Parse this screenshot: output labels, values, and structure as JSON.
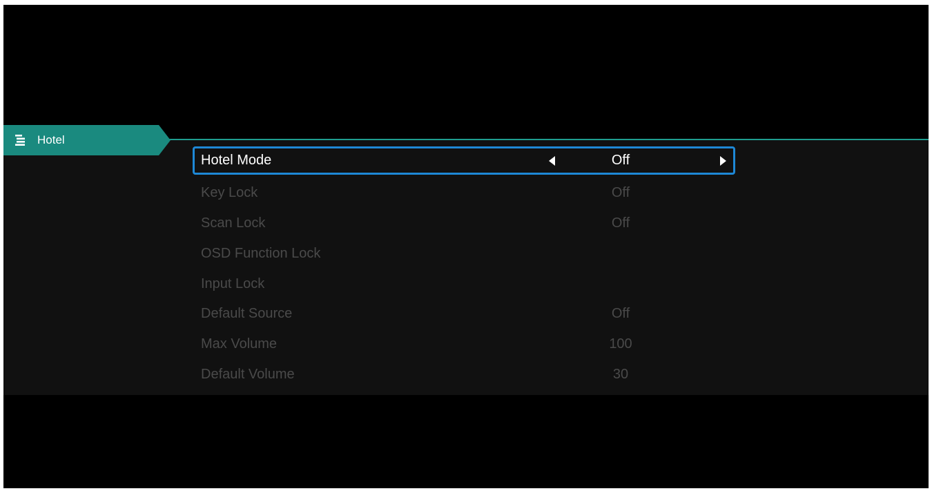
{
  "tab": {
    "label": "Hotel",
    "icon": "menu-list-icon"
  },
  "colors": {
    "accent": "#1a8a7f",
    "selection_border": "#1e88d6",
    "active_text": "#ffffff",
    "disabled_text": "#4a4a4a"
  },
  "items": [
    {
      "label": "Hotel Mode",
      "value": "Off"
    },
    {
      "label": "Key Lock",
      "value": "Off"
    },
    {
      "label": "Scan Lock",
      "value": "Off"
    },
    {
      "label": "OSD Function Lock",
      "value": ""
    },
    {
      "label": "Input Lock",
      "value": ""
    },
    {
      "label": "Default Source",
      "value": "Off"
    },
    {
      "label": "Max Volume",
      "value": "100"
    },
    {
      "label": "Default Volume",
      "value": "30"
    }
  ]
}
